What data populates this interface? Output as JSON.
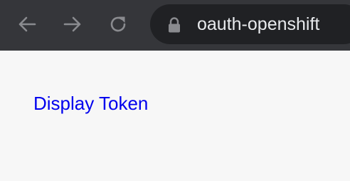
{
  "browser": {
    "address_bar": {
      "url": "oauth-openshift",
      "lock_icon": "lock-icon"
    },
    "nav": {
      "back_icon": "arrow-left-icon",
      "forward_icon": "arrow-right-icon",
      "reload_icon": "reload-icon"
    },
    "colors": {
      "toolbar": "#35363a",
      "omnibox": "#202124",
      "icon": "#8a8b8f",
      "page_background": "#f7f7f7",
      "link": "#0000ee"
    }
  },
  "page": {
    "link_label": "Display Token"
  }
}
